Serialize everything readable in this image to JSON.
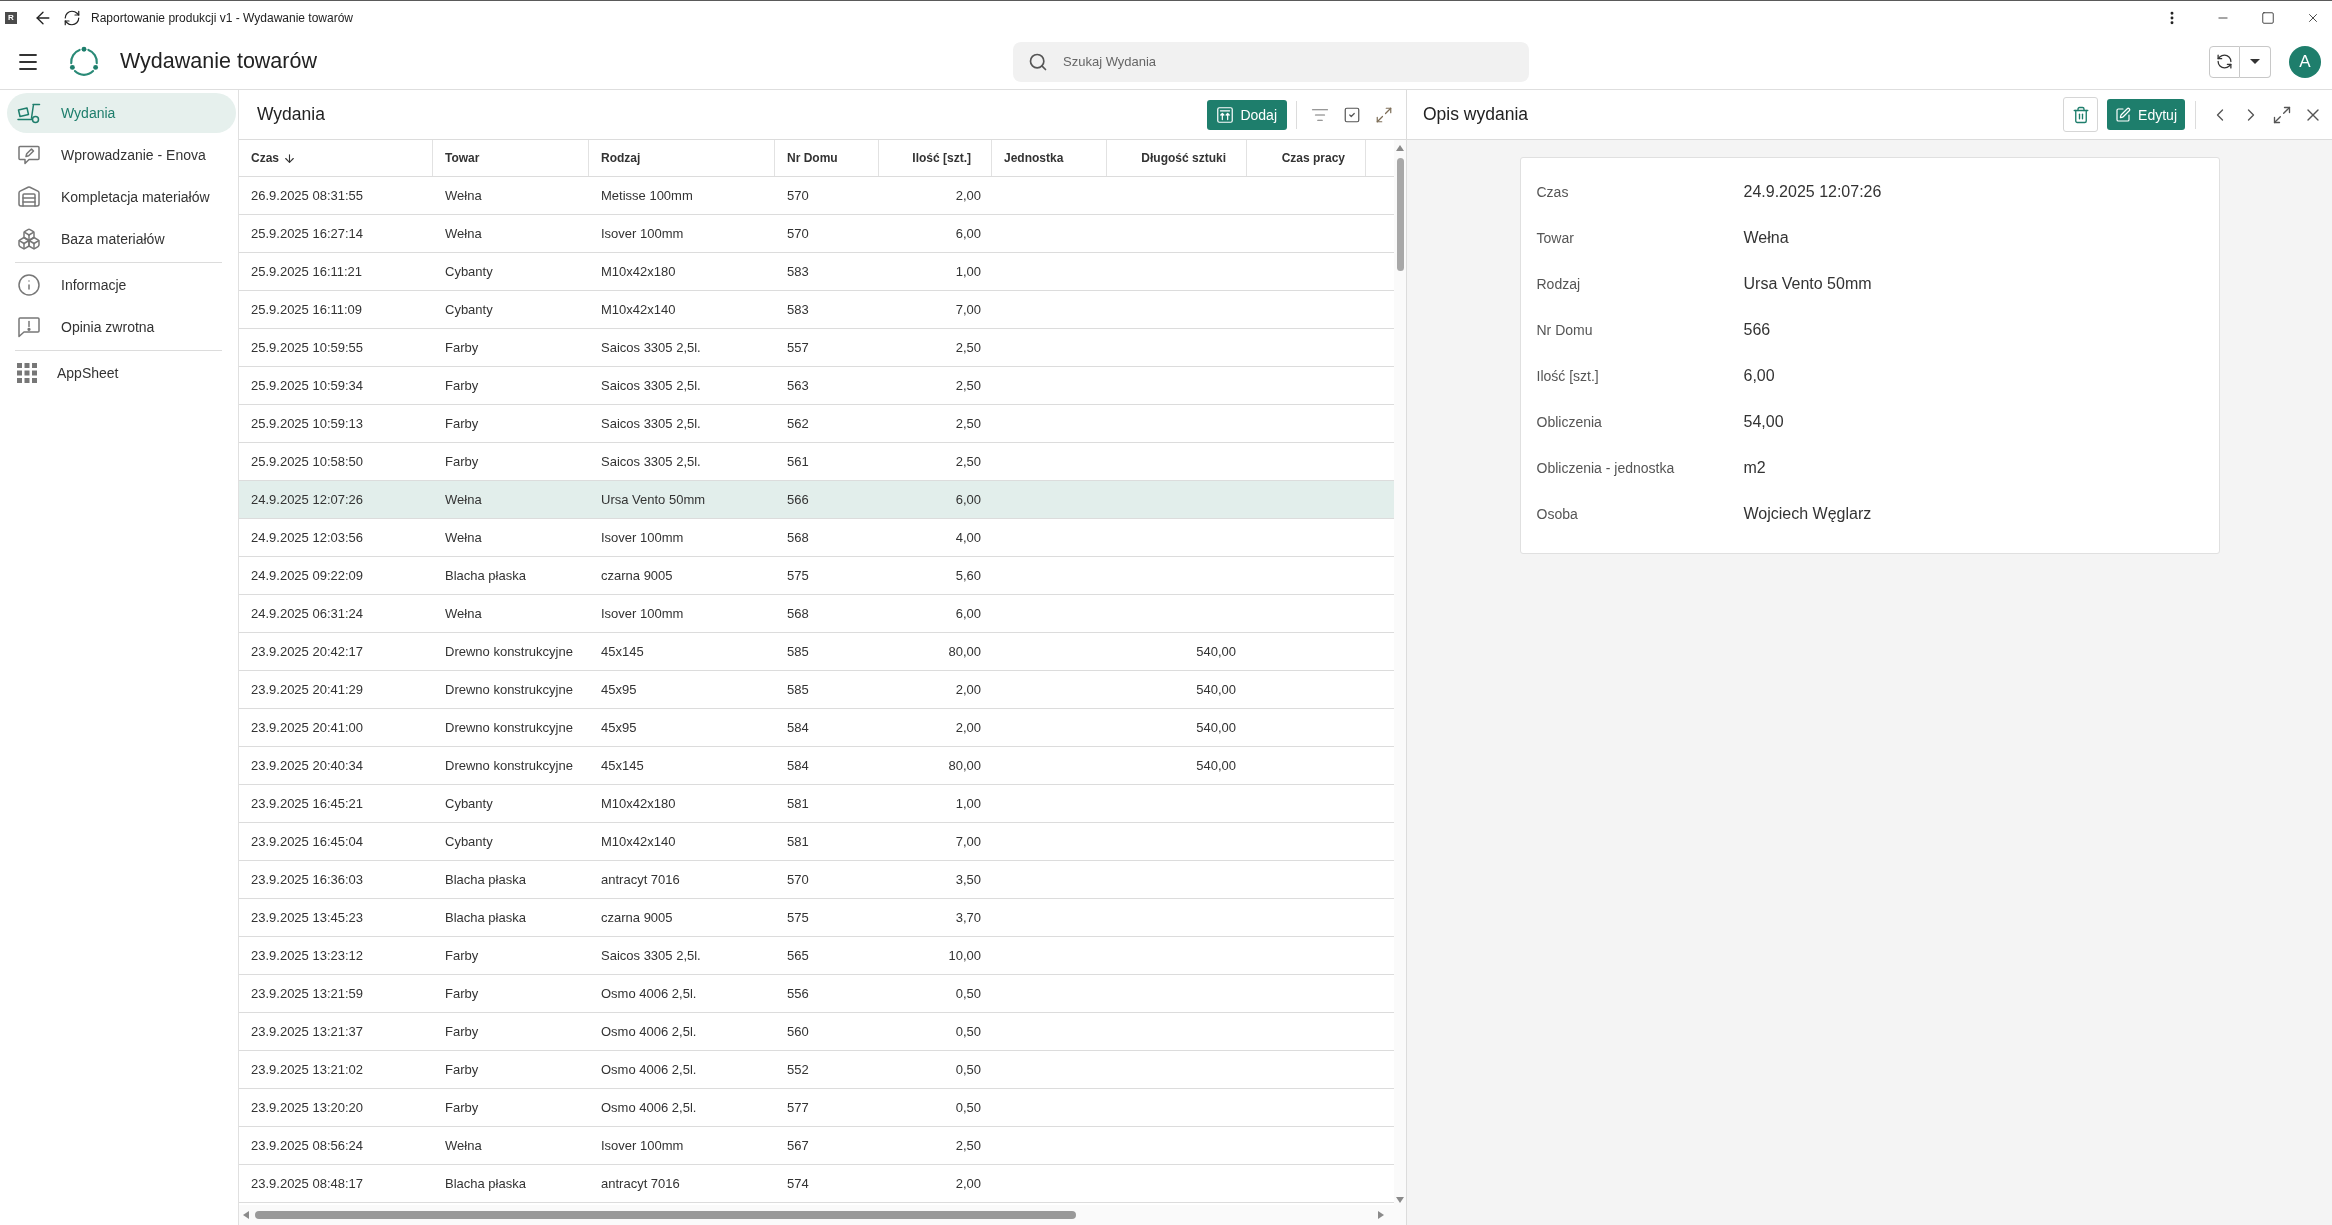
{
  "window": {
    "app_icon": "R",
    "title": "Raportowanie produkcji v1 - Wydawanie towarów"
  },
  "app_bar": {
    "title": "Wydawanie towarów",
    "search": {
      "placeholder": "Szukaj Wydania"
    },
    "avatar": "A"
  },
  "sidebar": {
    "groups": [
      {
        "items": [
          {
            "label": "Wydania",
            "selected": true
          },
          {
            "label": "Wprowadzanie - Enova",
            "selected": false
          },
          {
            "label": "Kompletacja materiałów",
            "selected": false
          },
          {
            "label": "Baza materiałów",
            "selected": false
          }
        ]
      },
      {
        "items": [
          {
            "label": "Informacje",
            "selected": false
          },
          {
            "label": "Opinia zwrotna",
            "selected": false
          }
        ]
      },
      {
        "items": [
          {
            "label": "AppSheet",
            "selected": false
          }
        ]
      }
    ]
  },
  "list": {
    "title": "Wydania",
    "add_button": "Dodaj",
    "table": {
      "columns": [
        {
          "label": "Czas",
          "kind": "datetime",
          "sorted": true
        },
        {
          "label": "Towar",
          "kind": "text",
          "sorted": false
        },
        {
          "label": "Rodzaj",
          "kind": "text",
          "sorted": false
        },
        {
          "label": "Nr Domu",
          "kind": "text",
          "sorted": false
        },
        {
          "label": "Ilość [szt.]",
          "kind": "number",
          "sorted": false
        },
        {
          "label": "Jednostka",
          "kind": "text",
          "sorted": false
        },
        {
          "label": "Długość sztuki",
          "kind": "number",
          "sorted": false
        },
        {
          "label": "Czas pracy",
          "kind": "duration",
          "sorted": false
        }
      ],
      "rows": [
        {
          "czas": "26.9.2025 08:31:55",
          "towar": "Wełna",
          "rodzaj": "Metisse 100mm",
          "nr_domu": "570",
          "ilosc": "2,00",
          "selected": false
        },
        {
          "czas": "25.9.2025 16:27:14",
          "towar": "Wełna",
          "rodzaj": "Isover 100mm",
          "nr_domu": "570",
          "ilosc": "6,00",
          "selected": false
        },
        {
          "czas": "25.9.2025 16:11:21",
          "towar": "Cybanty",
          "rodzaj": "M10x42x180",
          "nr_domu": "583",
          "ilosc": "1,00",
          "selected": false
        },
        {
          "czas": "25.9.2025 16:11:09",
          "towar": "Cybanty",
          "rodzaj": "M10x42x140",
          "nr_domu": "583",
          "ilosc": "7,00",
          "selected": false
        },
        {
          "czas": "25.9.2025 10:59:55",
          "towar": "Farby",
          "rodzaj": "Saicos 3305 2,5l.",
          "nr_domu": "557",
          "ilosc": "2,50",
          "selected": false
        },
        {
          "czas": "25.9.2025 10:59:34",
          "towar": "Farby",
          "rodzaj": "Saicos 3305 2,5l.",
          "nr_domu": "563",
          "ilosc": "2,50",
          "selected": false
        },
        {
          "czas": "25.9.2025 10:59:13",
          "towar": "Farby",
          "rodzaj": "Saicos 3305 2,5l.",
          "nr_domu": "562",
          "ilosc": "2,50",
          "selected": false
        },
        {
          "czas": "25.9.2025 10:58:50",
          "towar": "Farby",
          "rodzaj": "Saicos 3305 2,5l.",
          "nr_domu": "561",
          "ilosc": "2,50",
          "selected": false
        },
        {
          "czas": "24.9.2025 12:07:26",
          "towar": "Wełna",
          "rodzaj": "Ursa Vento 50mm",
          "nr_domu": "566",
          "ilosc": "6,00",
          "selected": true
        },
        {
          "czas": "24.9.2025 12:03:56",
          "towar": "Wełna",
          "rodzaj": "Isover 100mm",
          "nr_domu": "568",
          "ilosc": "4,00",
          "selected": false
        },
        {
          "czas": "24.9.2025 09:22:09",
          "towar": "Blacha płaska",
          "rodzaj": "czarna 9005",
          "nr_domu": "575",
          "ilosc": "5,60",
          "selected": false
        },
        {
          "czas": "24.9.2025 06:31:24",
          "towar": "Wełna",
          "rodzaj": "Isover 100mm",
          "nr_domu": "568",
          "ilosc": "6,00",
          "selected": false
        },
        {
          "czas": "23.9.2025 20:42:17",
          "towar": "Drewno konstrukcyjne",
          "rodzaj": "45x145",
          "nr_domu": "585",
          "ilosc": "80,00",
          "dlugosc_sztuki": "540,00",
          "selected": false
        },
        {
          "czas": "23.9.2025 20:41:29",
          "towar": "Drewno konstrukcyjne",
          "rodzaj": "45x95",
          "nr_domu": "585",
          "ilosc": "2,00",
          "dlugosc_sztuki": "540,00",
          "selected": false
        },
        {
          "czas": "23.9.2025 20:41:00",
          "towar": "Drewno konstrukcyjne",
          "rodzaj": "45x95",
          "nr_domu": "584",
          "ilosc": "2,00",
          "dlugosc_sztuki": "540,00",
          "selected": false
        },
        {
          "czas": "23.9.2025 20:40:34",
          "towar": "Drewno konstrukcyjne",
          "rodzaj": "45x145",
          "nr_domu": "584",
          "ilosc": "80,00",
          "dlugosc_sztuki": "540,00",
          "selected": false
        },
        {
          "czas": "23.9.2025 16:45:21",
          "towar": "Cybanty",
          "rodzaj": "M10x42x180",
          "nr_domu": "581",
          "ilosc": "1,00",
          "selected": false
        },
        {
          "czas": "23.9.2025 16:45:04",
          "towar": "Cybanty",
          "rodzaj": "M10x42x140",
          "nr_domu": "581",
          "ilosc": "7,00",
          "selected": false
        },
        {
          "czas": "23.9.2025 16:36:03",
          "towar": "Blacha płaska",
          "rodzaj": "antracyt 7016",
          "nr_domu": "570",
          "ilosc": "3,50",
          "selected": false
        },
        {
          "czas": "23.9.2025 13:45:23",
          "towar": "Blacha płaska",
          "rodzaj": "czarna 9005",
          "nr_domu": "575",
          "ilosc": "3,70",
          "selected": false
        },
        {
          "czas": "23.9.2025 13:23:12",
          "towar": "Farby",
          "rodzaj": "Saicos 3305 2,5l.",
          "nr_domu": "565",
          "ilosc": "10,00",
          "selected": false
        },
        {
          "czas": "23.9.2025 13:21:59",
          "towar": "Farby",
          "rodzaj": "Osmo 4006 2,5l.",
          "nr_domu": "556",
          "ilosc": "0,50",
          "selected": false
        },
        {
          "czas": "23.9.2025 13:21:37",
          "towar": "Farby",
          "rodzaj": "Osmo 4006 2,5l.",
          "nr_domu": "560",
          "ilosc": "0,50",
          "selected": false
        },
        {
          "czas": "23.9.2025 13:21:02",
          "towar": "Farby",
          "rodzaj": "Osmo 4006 2,5l.",
          "nr_domu": "552",
          "ilosc": "0,50",
          "selected": false
        },
        {
          "czas": "23.9.2025 13:20:20",
          "towar": "Farby",
          "rodzaj": "Osmo 4006 2,5l.",
          "nr_domu": "577",
          "ilosc": "0,50",
          "selected": false
        },
        {
          "czas": "23.9.2025 08:56:24",
          "towar": "Wełna",
          "rodzaj": "Isover 100mm",
          "nr_domu": "567",
          "ilosc": "2,50",
          "selected": false
        },
        {
          "czas": "23.9.2025 08:48:17",
          "towar": "Blacha płaska",
          "rodzaj": "antracyt 7016",
          "nr_domu": "574",
          "ilosc": "2,00",
          "selected": false
        }
      ]
    }
  },
  "detail": {
    "title": "Opis wydania",
    "edit_button": "Edytuj",
    "fields": [
      {
        "label": "Czas",
        "value": "24.9.2025 12:07:26"
      },
      {
        "label": "Towar",
        "value": "Wełna"
      },
      {
        "label": "Rodzaj",
        "value": "Ursa Vento 50mm"
      },
      {
        "label": "Nr Domu",
        "value": "566"
      },
      {
        "label": "Ilość [szt.]",
        "value": "6,00"
      },
      {
        "label": "Obliczenia",
        "value": "54,00"
      },
      {
        "label": "Obliczenia - jednostka",
        "value": "m2"
      },
      {
        "label": "Osoba",
        "value": "Wojciech Węglarz"
      }
    ]
  }
}
